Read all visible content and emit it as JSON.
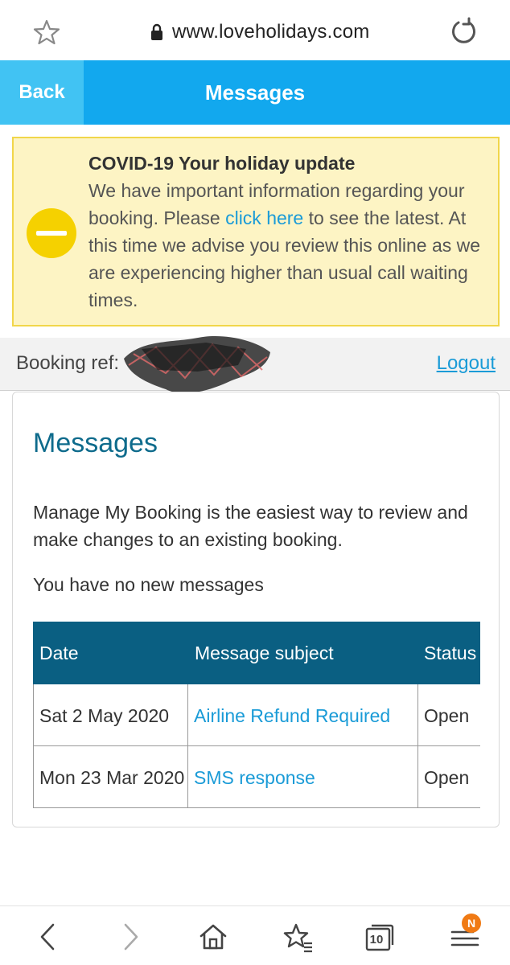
{
  "browser": {
    "url": "www.loveholidays.com"
  },
  "header": {
    "back_label": "Back",
    "title": "Messages"
  },
  "alert": {
    "title": "COVID-19 Your holiday update",
    "text_before": "We have important information regarding your booking. Please ",
    "link": "click here",
    "text_after": " to see the latest. At this time we advise you review this online as we are experiencing higher than usual call waiting times."
  },
  "booking": {
    "ref_label": "Booking ref:",
    "logout": "Logout"
  },
  "card": {
    "title": "Messages",
    "description": "Manage My Booking is the easiest way to review and make changes to an existing booking.",
    "empty_text": "You have no new messages"
  },
  "table": {
    "headers": [
      "Date",
      "Message subject",
      "Status"
    ],
    "rows": [
      {
        "date": "Sat 2 May 2020",
        "subject": "Airline Refund Required",
        "status": "Open"
      },
      {
        "date": "Mon 23 Mar 2020",
        "subject": "SMS response",
        "status": "Open"
      }
    ]
  },
  "bottom_nav": {
    "tabs_count": "10",
    "menu_badge": "N"
  },
  "colors": {
    "header_blue": "#12a8ee",
    "back_blue": "#41c3f3",
    "table_header": "#0a5f82",
    "link": "#1a9bd7",
    "alert_bg": "#fdf4c4",
    "badge": "#f07a14"
  }
}
